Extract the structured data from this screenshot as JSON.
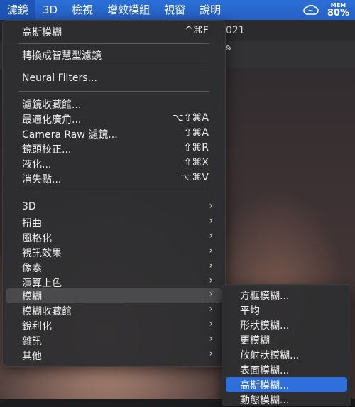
{
  "menubar": {
    "items": [
      "濾鏡",
      "3D",
      "檢視",
      "增效模組",
      "視窗",
      "說明"
    ],
    "active_index": 0,
    "mem_label": "MEM",
    "mem_value": "80%"
  },
  "document": {
    "tab_fragment": "021"
  },
  "filter_menu": {
    "items": [
      {
        "label": "高斯模糊",
        "shortcut": "^⌘F"
      },
      {
        "label": "轉換成智慧型濾鏡"
      },
      {
        "label": "Neural Filters..."
      },
      {
        "label": "濾鏡收藏館..."
      },
      {
        "label": "最適化廣角...",
        "shortcut": "⌥⇧⌘A"
      },
      {
        "label": "Camera Raw 濾鏡...",
        "shortcut": "⇧⌘A"
      },
      {
        "label": "鏡頭校正...",
        "shortcut": "⇧⌘R"
      },
      {
        "label": "液化...",
        "shortcut": "⇧⌘X"
      },
      {
        "label": "消失點...",
        "shortcut": "⌥⌘V"
      },
      {
        "label": "3D"
      },
      {
        "label": "扭曲"
      },
      {
        "label": "風格化"
      },
      {
        "label": "視訊效果"
      },
      {
        "label": "像素"
      },
      {
        "label": "演算上色"
      },
      {
        "label": "模糊"
      },
      {
        "label": "模糊收藏館"
      },
      {
        "label": "銳利化"
      },
      {
        "label": "雜訊"
      },
      {
        "label": "其他"
      }
    ]
  },
  "blur_submenu": {
    "items": [
      "方框模糊...",
      "平均",
      "形狀模糊...",
      "更模糊",
      "放射狀模糊...",
      "表面模糊...",
      "高斯模糊...",
      "動態模糊..."
    ],
    "selected_index": 6
  },
  "colors": {
    "menubar": "#2660c4",
    "selection": "#2f6fdb",
    "menu_bg": "#2e2e30"
  }
}
